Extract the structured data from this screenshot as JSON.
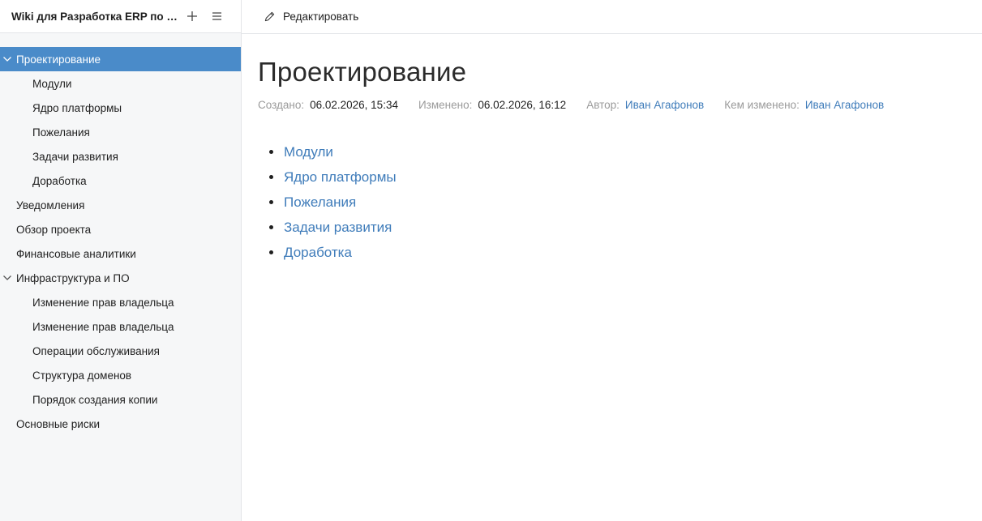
{
  "sidebar": {
    "title": "Wiki для Разработка ERP по з...",
    "add_icon": "plus-icon",
    "menu_icon": "hamburger-icon",
    "items": [
      {
        "label": "Проектирование",
        "level": 0,
        "expanded": true,
        "active": true
      },
      {
        "label": "Модули",
        "level": 1
      },
      {
        "label": "Ядро платформы",
        "level": 1
      },
      {
        "label": "Пожелания",
        "level": 1
      },
      {
        "label": "Задачи развития",
        "level": 1
      },
      {
        "label": "Доработка",
        "level": 1
      },
      {
        "label": "Уведомления",
        "level": 0
      },
      {
        "label": "Обзор проекта",
        "level": 0
      },
      {
        "label": "Финансовые аналитики",
        "level": 0
      },
      {
        "label": "Инфраструктура и ПО",
        "level": 0,
        "expanded": true
      },
      {
        "label": "Изменение прав владельца",
        "level": 1
      },
      {
        "label": "Изменение прав владельца",
        "level": 1
      },
      {
        "label": "Операции обслуживания",
        "level": 1
      },
      {
        "label": "Структура доменов",
        "level": 1
      },
      {
        "label": "Порядок создания копии",
        "level": 1
      },
      {
        "label": "Основные риски",
        "level": 0
      }
    ]
  },
  "toolbar": {
    "edit_label": "Редактировать",
    "edit_icon": "pencil-icon"
  },
  "page": {
    "title": "Проектирование",
    "meta": {
      "created_label": "Создано:",
      "created_value": "06.02.2026, 15:34",
      "modified_label": "Изменено:",
      "modified_value": "06.02.2026, 16:12",
      "author_label": "Автор:",
      "author_value": "Иван Агафонов",
      "modified_by_label": "Кем изменено:",
      "modified_by_value": "Иван Агафонов"
    },
    "children": [
      "Модули",
      "Ядро платформы",
      "Пожелания",
      "Задачи развития",
      "Доработка"
    ]
  },
  "colors": {
    "accent": "#4a8bc9",
    "link": "#3f7cba",
    "muted": "#9a9a9a"
  }
}
